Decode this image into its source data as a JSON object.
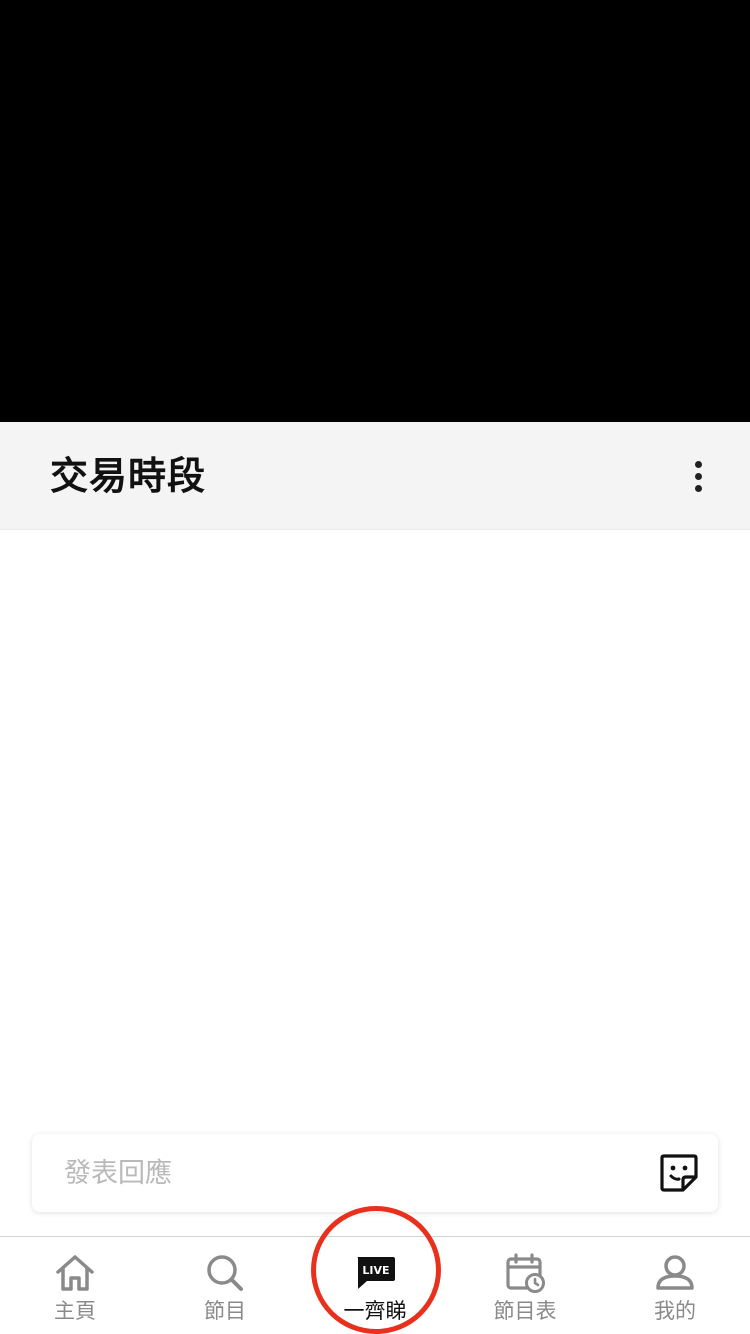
{
  "header": {
    "title": "交易時段"
  },
  "comment": {
    "placeholder": "發表回應"
  },
  "tabs": [
    {
      "label": "主頁",
      "icon": "home-icon"
    },
    {
      "label": "節目",
      "icon": "search-icon"
    },
    {
      "label": "一齊睇",
      "icon": "live-chat-icon",
      "badge": "LIVE",
      "active": true
    },
    {
      "label": "節目表",
      "icon": "calendar-clock-icon"
    },
    {
      "label": "我的",
      "icon": "profile-icon"
    }
  ],
  "colors": {
    "video_background": "#000000",
    "title_bar_background": "#f4f4f4",
    "highlight_ring": "#e8301c",
    "inactive_tab": "#8a8a8a",
    "active_tab": "#111111"
  }
}
